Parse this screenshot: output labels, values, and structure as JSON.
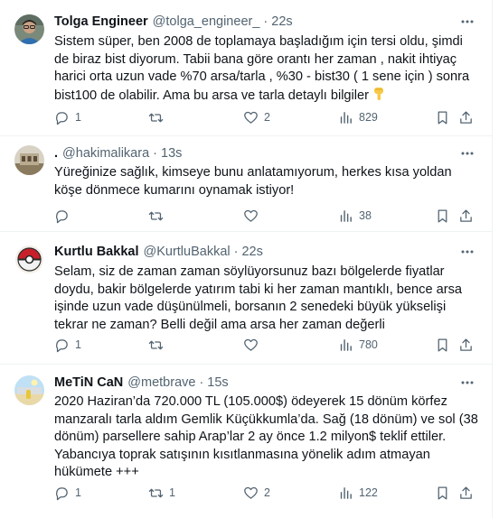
{
  "tweets": [
    {
      "name": "Tolga Engineer",
      "handle": "@tolga_engineer_",
      "time": "22s",
      "text": "Sistem süper, ben 2008 de toplamaya başladığım için tersi oldu, şimdi de biraz bist diyorum. Tabii bana göre orantı her zaman , nakit ihtiyaç harici orta uzun vade %70 arsa/tarla , %30 - bist30 ( 1 sene için ) sonra bist100 de olabilir. Ama bu arsa ve tarla detaylı bilgiler",
      "emoji": "pointing-down-emoji",
      "replies": "1",
      "retweets": "",
      "likes": "2",
      "views": "829"
    },
    {
      "name": ".",
      "handle": "@hakimalikara",
      "time": "13s",
      "text": "Yüreğinize sağlık,  kimseye bunu anlatamıyorum, herkes kısa yoldan köşe dönmece kumarını oynamak istiyor!",
      "replies": "",
      "retweets": "",
      "likes": "",
      "views": "38"
    },
    {
      "name": "Kurtlu Bakkal",
      "handle": "@KurtluBakkal",
      "time": "22s",
      "text": "Selam, siz de zaman zaman söylüyorsunuz bazı bölgelerde fiyatlar doydu, bakir bölgelerde yatırım tabi ki her zaman mantıklı, bence arsa işinde uzun vade düşünülmeli, borsanın 2 senedeki büyük yükselişi tekrar ne zaman? Belli değil ama arsa her zaman değerli",
      "replies": "1",
      "retweets": "",
      "likes": "",
      "views": "780"
    },
    {
      "name": "MeTiN CaN",
      "handle": "@metbrave",
      "time": "15s",
      "text": "2020 Haziran’da 720.000 TL (105.000$) ödeyerek 15 dönüm körfez manzaralı tarla aldım Gemlik Küçükkumla’da. Sağ (18 dönüm) ve sol (38 dönüm) parsellere sahip Arap’lar 2 ay önce 1.2 milyon$ teklif ettiler. Yabancıya toprak satışının kısıtlanmasına yönelik adım atmayan hükümete +++",
      "replies": "1",
      "retweets": "1",
      "likes": "2",
      "views": "122"
    }
  ],
  "icons": {
    "more": "more-horizontal-icon",
    "reply": "reply-icon",
    "retweet": "retweet-icon",
    "like": "heart-icon",
    "views": "views-chart-icon",
    "bookmark": "bookmark-icon",
    "share": "share-icon"
  },
  "colors": {
    "text": "#0f1419",
    "secondary": "#536471",
    "divider": "#eff3f4",
    "emoji": "#f7c948"
  }
}
